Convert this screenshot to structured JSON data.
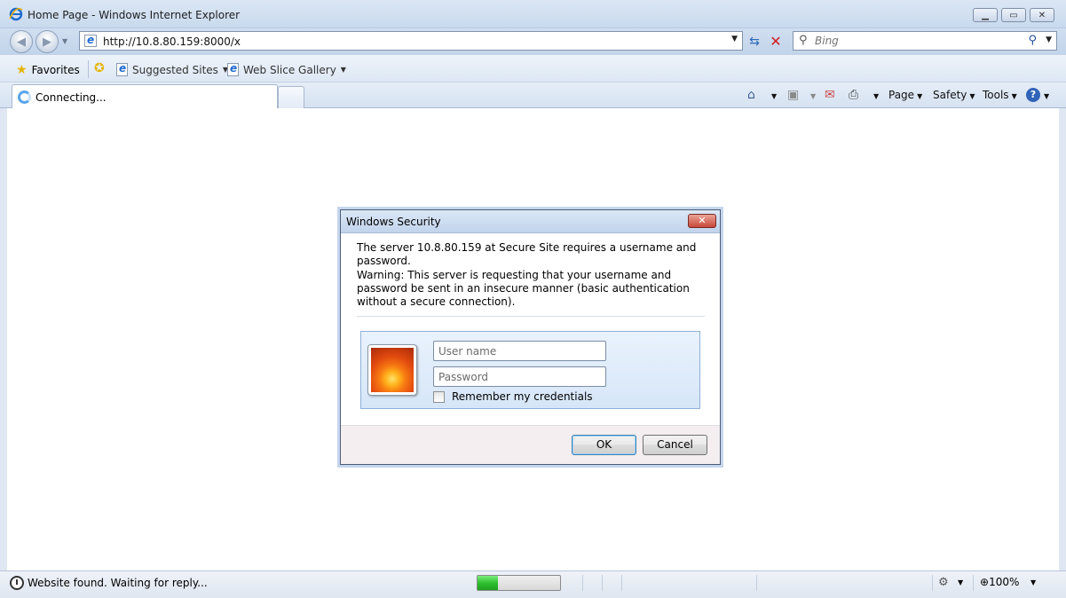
{
  "window": {
    "title": "Home Page - Windows Internet Explorer",
    "minimize_icon": "minimize-icon",
    "maximize_icon": "maximize-icon",
    "close_icon": "close-icon"
  },
  "address_bar": {
    "url": "http://10.8.80.159:8000/x",
    "refresh_icon": "refresh-icon",
    "stop_icon": "stop-icon"
  },
  "search": {
    "placeholder": "Bing"
  },
  "favorites_bar": {
    "favorites_label": "Favorites",
    "links": [
      "Suggested Sites",
      "Web Slice Gallery"
    ]
  },
  "tabs": {
    "active_label": "Connecting..."
  },
  "command_bar": {
    "page_label": "Page",
    "safety_label": "Safety",
    "tools_label": "Tools"
  },
  "dialog": {
    "title": "Windows Security",
    "message": "The server 10.8.80.159 at Secure Site requires a username and password.",
    "warning": "Warning: This server is requesting that your username and password be sent in an insecure manner (basic authentication without a secure connection).",
    "username_placeholder": "User name",
    "password_placeholder": "Password",
    "remember_label": "Remember my credentials",
    "ok_label": "OK",
    "cancel_label": "Cancel"
  },
  "status_bar": {
    "text": "Website found. Waiting for reply...",
    "progress": 0.25,
    "zoom": "100%"
  },
  "colors": {
    "progress_green": "#2fc02f",
    "close_red": "#c8473a",
    "chrome_blue": "#c9daee"
  }
}
